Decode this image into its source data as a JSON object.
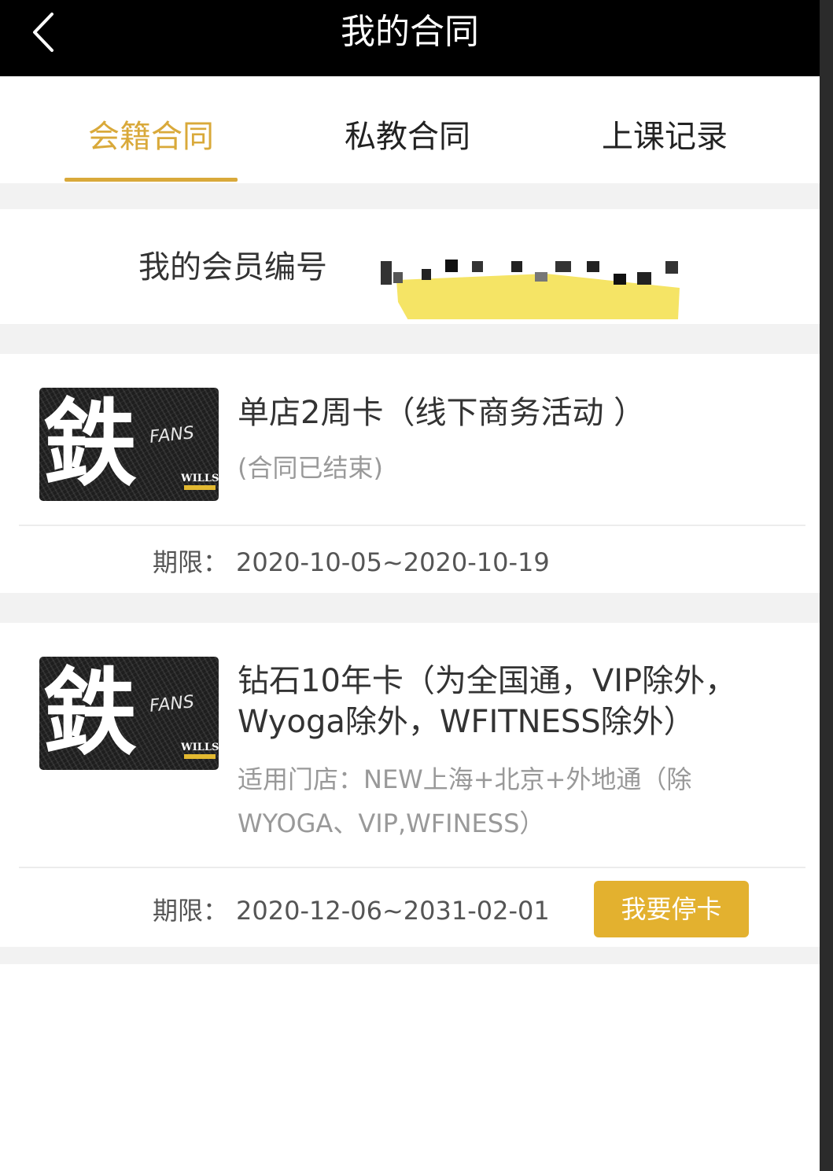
{
  "header": {
    "title": "我的合同",
    "back_icon": "chevron-left-icon"
  },
  "tabs": [
    {
      "label": "会籍合同",
      "active": true
    },
    {
      "label": "私教合同",
      "active": false
    },
    {
      "label": "上课记录",
      "active": false
    }
  ],
  "member": {
    "label": "我的会员编号"
  },
  "contracts": [
    {
      "title": "单店2周卡（线下商务活动 ）",
      "subtitle": "(合同已结束)",
      "period_label": "期限：",
      "period_value": "2020-10-05~2020-10-19"
    },
    {
      "title": "钻石10年卡（为全国通，VIP除外，Wyoga除外，WFITNESS除外）",
      "subtitle": "适用门店：NEW上海+北京+外地通（除WYOGA、VIP,WFINESS）",
      "period_label": "期限：",
      "period_value": "2020-12-06~2031-02-01",
      "action_label": "我要停卡"
    }
  ],
  "card_image": {
    "char": "鉄",
    "fans": "FANS",
    "brand": "WILLS"
  },
  "colors": {
    "accent": "#d9a93a",
    "button": "#e3b12f",
    "header_bg": "#000000",
    "separator": "#f2f2f2"
  }
}
